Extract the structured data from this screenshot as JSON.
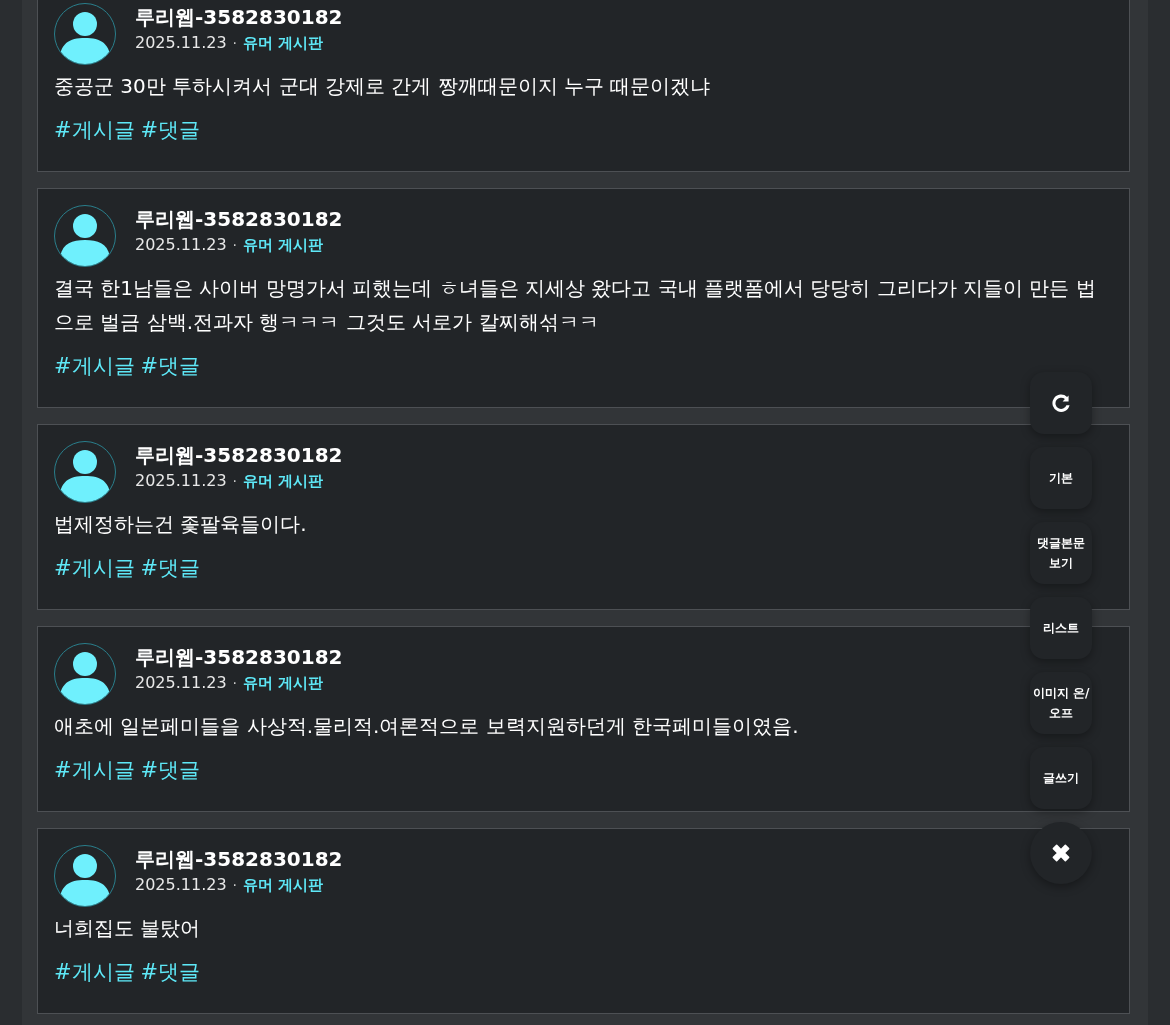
{
  "posts": [
    {
      "author": "루리웹-3582830182",
      "date": "2025.11.23",
      "separator": "·",
      "board": "유머 게시판",
      "body": "중공군 30만 투하시켜서 군대 강제로 간게 짱깨때문이지 누구 때문이겠냐",
      "tags": [
        "#게시글",
        "#댓글"
      ]
    },
    {
      "author": "루리웹-3582830182",
      "date": "2025.11.23",
      "separator": "·",
      "board": "유머 게시판",
      "body": "결국 한1남들은 사이버 망명가서 피했는데 ㅎ녀들은 지세상 왔다고 국내 플랫폼에서 당당히 그리다가 지들이 만든 법으로 벌금 삼백.전과자 행ㅋㅋㅋ 그것도 서로가 칼찌해섞ㅋㅋ",
      "tags": [
        "#게시글",
        "#댓글"
      ]
    },
    {
      "author": "루리웹-3582830182",
      "date": "2025.11.23",
      "separator": "·",
      "board": "유머 게시판",
      "body": "법제정하는건 좇팔육들이다.",
      "tags": [
        "#게시글",
        "#댓글"
      ]
    },
    {
      "author": "루리웹-3582830182",
      "date": "2025.11.23",
      "separator": "·",
      "board": "유머 게시판",
      "body": "애초에 일본페미들을 사상적.물리적.여론적으로 보력지원하던게 한국페미들이였음.",
      "tags": [
        "#게시글",
        "#댓글"
      ]
    },
    {
      "author": "루리웹-3582830182",
      "date": "2025.11.23",
      "separator": "·",
      "board": "유머 게시판",
      "body": "너희집도 불탔어",
      "tags": [
        "#게시글",
        "#댓글"
      ]
    }
  ],
  "floating_menu": [
    {
      "kind": "refresh"
    },
    {
      "kind": "text",
      "label": "기본"
    },
    {
      "kind": "text",
      "label": "댓글본문 보기"
    },
    {
      "kind": "text",
      "label": "리스트"
    },
    {
      "kind": "text",
      "label": "이미지 온/ 오프"
    },
    {
      "kind": "text",
      "label": "글쓰기"
    },
    {
      "kind": "close"
    }
  ]
}
